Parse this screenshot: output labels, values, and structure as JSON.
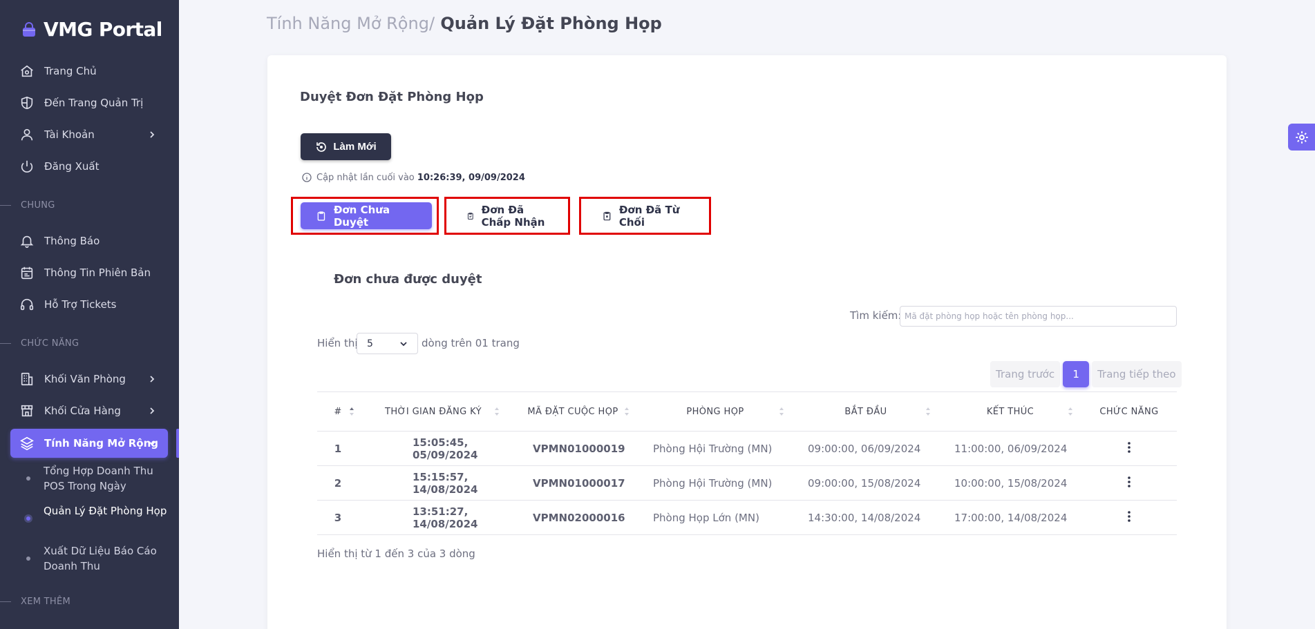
{
  "sidebar": {
    "brand": "VMG Portal",
    "top_items": [
      {
        "label": "Trang Chủ"
      },
      {
        "label": "Đến Trang Quản Trị"
      },
      {
        "label": "Tài Khoản"
      },
      {
        "label": "Đăng Xuất"
      }
    ],
    "section_general": "CHUNG",
    "general_items": [
      {
        "label": "Thông Báo"
      },
      {
        "label": "Thông Tin Phiên Bản"
      },
      {
        "label": "Hỗ Trợ Tickets"
      }
    ],
    "section_functions": "CHỨC NĂNG",
    "function_items": [
      {
        "label": "Khối Văn Phòng"
      },
      {
        "label": "Khối Cửa Hàng"
      },
      {
        "label": "Tính Năng Mở Rộng"
      }
    ],
    "sub_items": [
      {
        "label": "Tổng Hợp Doanh Thu POS Trong Ngày"
      },
      {
        "label": "Quản Lý Đặt Phòng Họp"
      },
      {
        "label": "Xuất Dữ Liệu Báo Cáo Doanh Thu"
      }
    ],
    "section_more": "XEM THÊM"
  },
  "breadcrumb": {
    "parent": "Tính Năng Mở Rộng/",
    "current": " Quản Lý Đặt Phòng Họp"
  },
  "card": {
    "title": "Duyệt Đơn Đặt Phòng Họp",
    "refresh_label": "Làm Mới",
    "updated_prefix": "Cập nhật lần cuối vào ",
    "updated_time": "10:26:39, 09/09/2024",
    "tabs": [
      {
        "label": "Đơn Chưa Duyệt"
      },
      {
        "label": "Đơn Đã Chấp Nhận"
      },
      {
        "label": "Đơn Đã Từ Chối"
      }
    ],
    "subtitle": "Đơn chưa được duyệt"
  },
  "table_controls": {
    "search_label": "Tìm kiếm:",
    "search_placeholder": "Mã đặt phòng họp hoặc tên phòng họp...",
    "search_value": "",
    "length_prefix": "Hiển thị",
    "length_value": "5",
    "length_suffix": "dòng trên 01 trang",
    "prev_label": "Trang trước",
    "current_page": "1",
    "next_label": "Trang tiếp theo"
  },
  "table": {
    "headers": [
      "#",
      "THỜI GIAN ĐĂNG KÝ",
      "MÃ ĐẶT CUỘC HỌP",
      "PHÒNG HỌP",
      "BẮT ĐẦU",
      "KẾT THÚC",
      "CHỨC NĂNG"
    ],
    "rows": [
      {
        "no": "1",
        "registered": "15:05:45, 05/09/2024",
        "code": "VPMN01000019",
        "room": "Phòng Hội Trường (MN)",
        "start": "09:00:00, 06/09/2024",
        "end": "11:00:00, 06/09/2024"
      },
      {
        "no": "2",
        "registered": "15:15:57, 14/08/2024",
        "code": "VPMN01000017",
        "room": "Phòng Hội Trường (MN)",
        "start": "09:00:00, 15/08/2024",
        "end": "10:00:00, 15/08/2024"
      },
      {
        "no": "3",
        "registered": "13:51:27, 14/08/2024",
        "code": "VPMN02000016",
        "room": "Phòng Họp Lớn (MN)",
        "start": "14:30:00, 14/08/2024",
        "end": "17:00:00, 14/08/2024"
      }
    ],
    "info": "Hiển thị từ 1 đến 3 của 3 dòng"
  },
  "colors": {
    "sidebar": "#2f3349",
    "primary": "#7367f0",
    "highlight_box": "#e00000"
  },
  "icons": [
    "bag-icon",
    "home-icon",
    "shield-icon",
    "user-icon",
    "power-icon",
    "bell-icon",
    "calendar-icon",
    "headset-icon",
    "building-icon",
    "store-icon",
    "layers-icon",
    "chevron-right-icon",
    "chevron-down-icon",
    "refresh-icon",
    "info-icon",
    "clipboard-icon",
    "clipboard-check-icon",
    "clipboard-x-icon",
    "sort-icon",
    "kebab-icon",
    "gear-icon"
  ]
}
